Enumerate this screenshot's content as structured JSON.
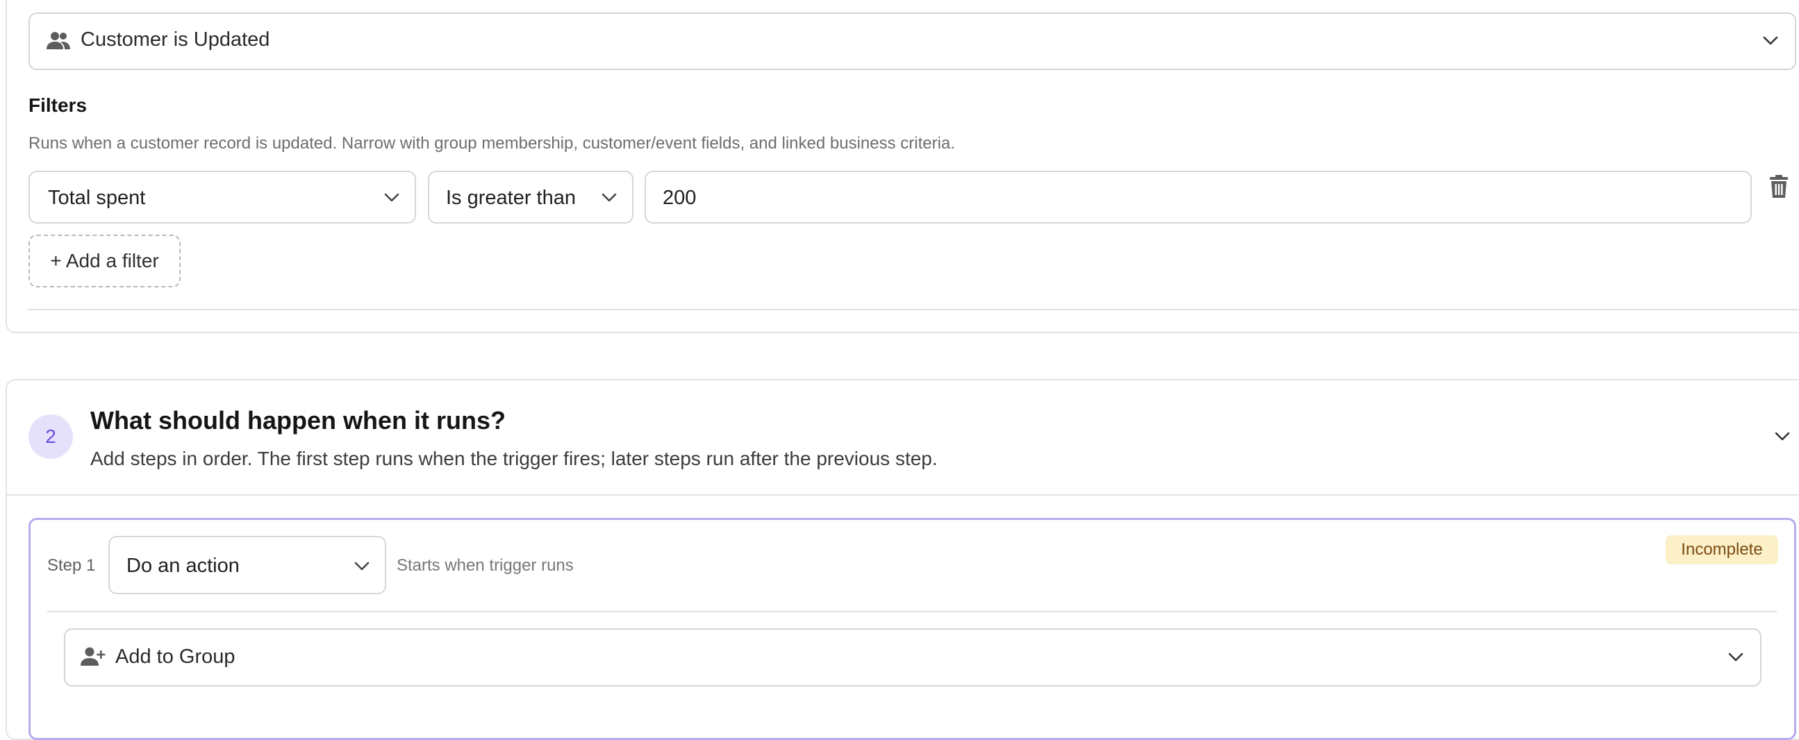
{
  "trigger": {
    "icon": "people-icon",
    "label": "Customer is Updated"
  },
  "filters": {
    "title": "Filters",
    "description": "Runs when a customer record is updated. Narrow with group membership, customer/event fields, and linked business criteria.",
    "rows": [
      {
        "field": "Total spent",
        "operator": "Is greater than",
        "value": "200"
      }
    ],
    "add_label": "+ Add a filter"
  },
  "section2": {
    "number": "2",
    "title": "What should happen when it runs?",
    "description": "Add steps in order. The first step runs when the trigger fires; later steps run after the previous step."
  },
  "step1": {
    "label": "Step 1",
    "type_value": "Do an action",
    "hint": "Starts when trigger runs",
    "status": "Incomplete",
    "action": {
      "icon": "person-add-icon",
      "label": "Add to Group"
    }
  },
  "colors": {
    "accent": "#6c4be0",
    "accent_border": "#b7abef",
    "badge_bg": "#fbf0c7",
    "badge_text": "#7a4b12"
  }
}
